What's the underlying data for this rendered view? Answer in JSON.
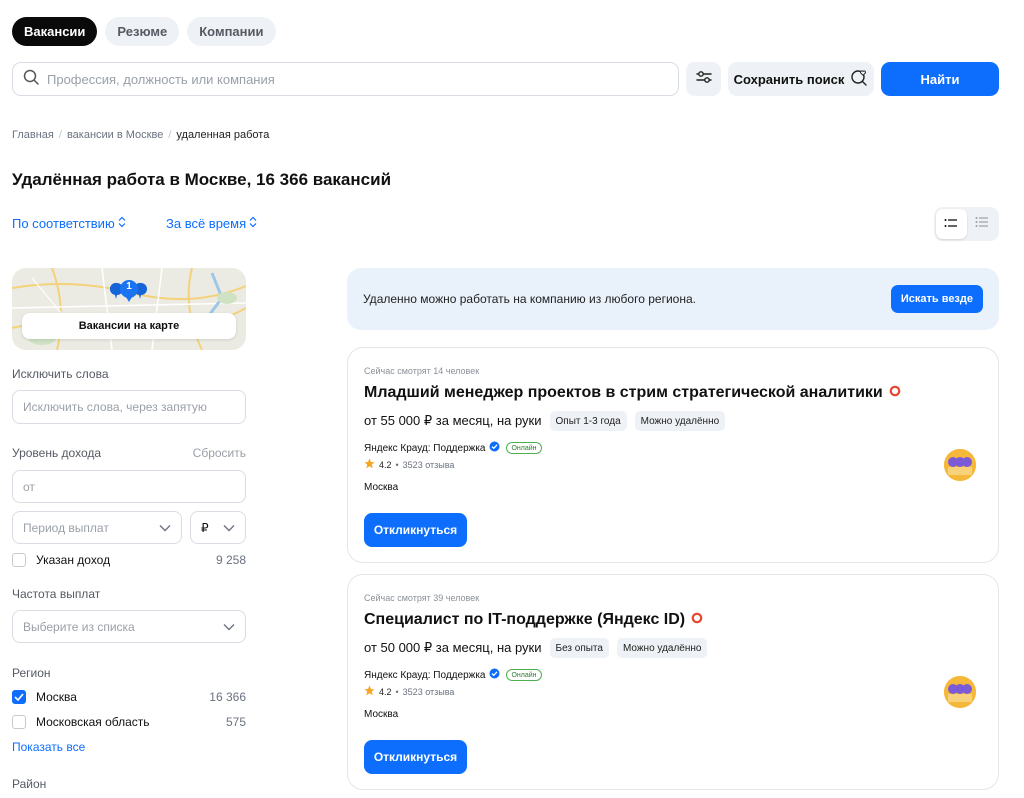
{
  "tabs": [
    {
      "label": "Вакансии",
      "active": true
    },
    {
      "label": "Резюме",
      "active": false
    },
    {
      "label": "Компании",
      "active": false
    }
  ],
  "search": {
    "placeholder": "Профессия, должность или компания",
    "save_label": "Сохранить поиск",
    "find_label": "Найти",
    "icon": "search-icon"
  },
  "breadcrumb": [
    "Главная",
    "вакансии в Москве",
    "удаленная работа"
  ],
  "page_title": "Удалённая работа в Москве, 16 366 вакансий",
  "sort": {
    "relevance": "По соответствию",
    "period": "За всё время"
  },
  "map": {
    "cluster_count": "1",
    "button_label": "Вакансии на карте"
  },
  "filters": {
    "exclude_label": "Исключить слова",
    "exclude_placeholder": "Исключить слова, через запятую",
    "income_label": "Уровень дохода",
    "income_reset": "Сбросить",
    "income_placeholder": "от",
    "period_placeholder": "Период выплат",
    "currency": "₽",
    "income_specified_label": "Указан доход",
    "income_specified_count": "9 258",
    "frequency_label": "Частота выплат",
    "frequency_placeholder": "Выберите из списка",
    "region_label": "Регион",
    "regions": [
      {
        "name": "Москва",
        "count": "16 366",
        "checked": true
      },
      {
        "name": "Московская область",
        "count": "575",
        "checked": false
      }
    ],
    "show_all": "Показать все",
    "district_label": "Район"
  },
  "banner": {
    "text": "Удаленно можно работать на компанию из любого региона.",
    "button": "Искать везде"
  },
  "vacancies": [
    {
      "viewers": "Сейчас смотрят 14 человек",
      "title": "Младший менеджер проектов в стрим стратегической аналитики",
      "salary": "от 55 000 ₽ за месяц, на руки",
      "experience": "Опыт 1-3 года",
      "remote": "Можно удалённо",
      "company": "Яндекс Крауд: Поддержка",
      "online": "Онлайн",
      "rating": "4.2",
      "reviews": "3523 отзыва",
      "city": "Москва",
      "apply": "Откликнуться"
    },
    {
      "viewers": "Сейчас смотрят 39 человек",
      "title": "Специалист по IT-поддержке (Яндекс ID)",
      "salary": "от 50 000 ₽ за месяц, на руки",
      "experience": "Без опыта",
      "remote": "Можно удалённо",
      "company": "Яндекс Крауд: Поддержка",
      "online": "Онлайн",
      "rating": "4.2",
      "reviews": "3523 отзыва",
      "city": "Москва",
      "apply": "Откликнуться"
    }
  ],
  "colors": {
    "accent": "#0d6efd",
    "banner_bg": "#e9f1fb",
    "chip_bg": "#eef1f5",
    "hot": "#e8442c"
  }
}
